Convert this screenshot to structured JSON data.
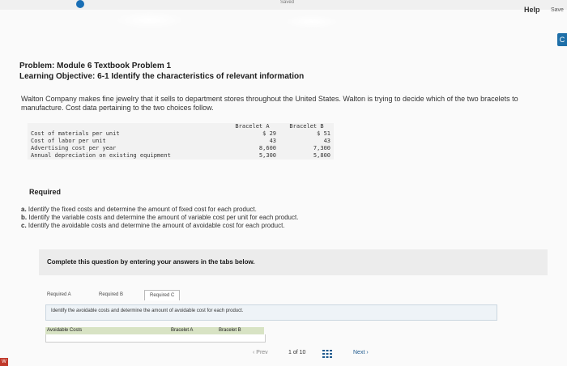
{
  "header": {
    "saved_label": "Saved",
    "help_label": "Help",
    "save_label": "Save"
  },
  "problem": {
    "title": "Problem: Module 6 Textbook Problem 1",
    "objective": "Learning Objective: 6-1 Identify the characteristics of relevant information",
    "intro": "Walton Company makes fine jewelry that it sells to department stores throughout the United States. Walton is trying to decide which of the two bracelets to manufacture. Cost data pertaining to the two choices follow."
  },
  "cost_table": {
    "headers": [
      "",
      "Bracelet A",
      "Bracelet B"
    ],
    "rows": [
      {
        "label": "Cost of materials per unit",
        "a": "$   29",
        "b": "$   51"
      },
      {
        "label": "Cost of labor per unit",
        "a": "43",
        "b": "43"
      },
      {
        "label": "Advertising cost per year",
        "a": "8,600",
        "b": "7,300"
      },
      {
        "label": "Annual depreciation on existing equipment",
        "a": "5,300",
        "b": "5,800"
      }
    ]
  },
  "required": {
    "heading": "Required",
    "items": [
      {
        "letter": "a.",
        "text": "Identify the fixed costs and determine the amount of fixed cost for each product."
      },
      {
        "letter": "b.",
        "text": "Identify the variable costs and determine the amount of variable cost per unit for each product."
      },
      {
        "letter": "c.",
        "text": "Identify the avoidable costs and determine the amount of avoidable cost for each product."
      }
    ]
  },
  "instruction": "Complete this question by entering your answers in the tabs below.",
  "tabs": [
    "Required A",
    "Required B",
    "Required C"
  ],
  "active_tab": "Required C",
  "question": "Identify the avoidable costs and determine the amount of avoidable cost for each product.",
  "answer_table": {
    "headers": [
      "Avoidable Costs",
      "Bracelet A",
      "Bracelet B"
    ]
  },
  "pager": {
    "prev_label": "Prev",
    "count_label": "1 of 10",
    "next_label": "Next"
  },
  "side_badge": "C",
  "corner_badge": "W"
}
